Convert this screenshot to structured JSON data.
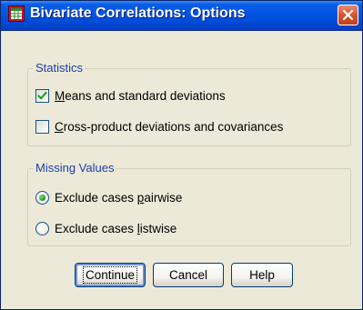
{
  "window": {
    "title": "Bivariate Correlations: Options"
  },
  "statistics": {
    "legend": "Statistics",
    "means": {
      "label": "Means and standard deviations",
      "checked": true
    },
    "crossproduct": {
      "label": "Cross-product deviations and covariances",
      "checked": false
    }
  },
  "missing": {
    "legend": "Missing Values",
    "pairwise": {
      "label": "Exclude cases pairwise",
      "selected": true
    },
    "listwise": {
      "label": "Exclude cases listwise",
      "selected": false
    }
  },
  "buttons": {
    "continue_label": "Continue",
    "cancel_label": "Cancel",
    "help_label": "Help"
  },
  "colors": {
    "titlebar": "#0054e3",
    "legend_text": "#1c3fa8",
    "close_button": "#d6542d",
    "radio_dot": "#21a121"
  },
  "icons": {
    "title": "spss-dialog-icon",
    "close": "close-icon",
    "check": "checkmark-icon"
  }
}
